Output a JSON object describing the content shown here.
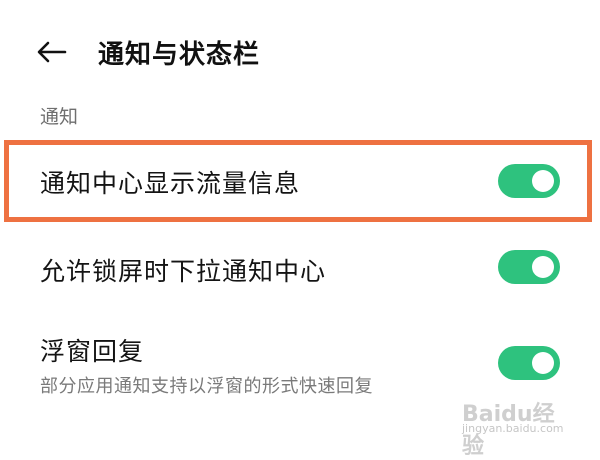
{
  "header": {
    "title": "通知与状态栏"
  },
  "section": {
    "label": "通知"
  },
  "settings": [
    {
      "label": "通知中心显示流量信息",
      "enabled": true
    },
    {
      "label": "允许锁屏时下拉通知中心",
      "enabled": true
    },
    {
      "label": "浮窗回复",
      "sub": "部分应用通知支持以浮窗的形式快速回复",
      "enabled": true
    }
  ],
  "watermark": {
    "brand": "Baidu经验",
    "url": "jingyan.baidu.com"
  },
  "colors": {
    "toggle_on": "#2ec27e",
    "highlight": "#ee7141"
  }
}
